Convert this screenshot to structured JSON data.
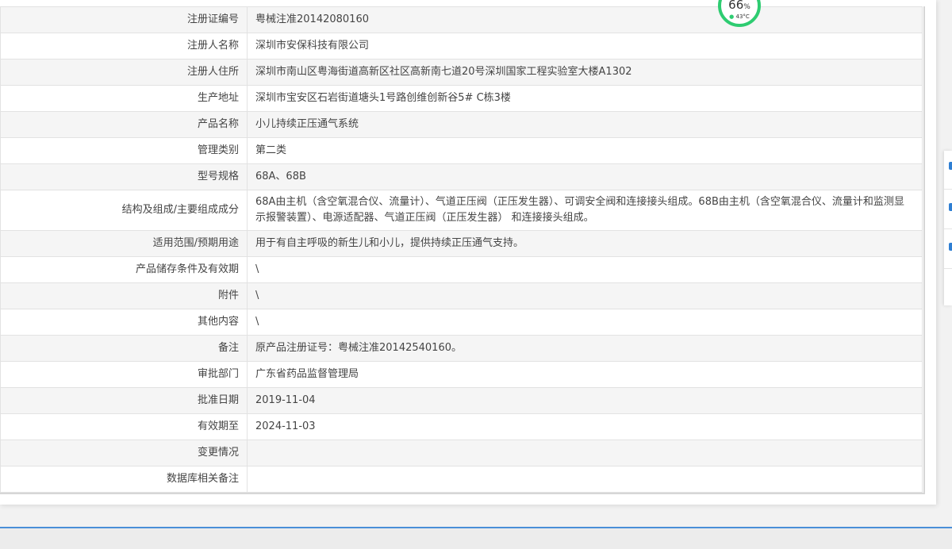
{
  "record": {
    "rows": [
      {
        "label": "注册证编号",
        "value": "粤械注准20142080160"
      },
      {
        "label": "注册人名称",
        "value": "深圳市安保科技有限公司"
      },
      {
        "label": "注册人住所",
        "value": "深圳市南山区粤海街道高新区社区高新南七道20号深圳国家工程实验室大楼A1302"
      },
      {
        "label": "生产地址",
        "value": "深圳市宝安区石岩街道塘头1号路创维创新谷5# C栋3楼"
      },
      {
        "label": "产品名称",
        "value": "小儿持续正压通气系统"
      },
      {
        "label": "管理类别",
        "value": "第二类"
      },
      {
        "label": "型号规格",
        "value": "68A、68B"
      },
      {
        "label": "结构及组成/主要组成成分",
        "value": "68A由主机（含空氧混合仪、流量计）、气道正压阀（正压发生器）、可调安全阀和连接接头组成。68B由主机（含空氧混合仪、流量计和监测显示报警装置）、电源适配器、气道正压阀（正压发生器） 和连接接头组成。"
      },
      {
        "label": "适用范围/预期用途",
        "value": "用于有自主呼吸的新生儿和小儿，提供持续正压通气支持。"
      },
      {
        "label": "产品储存条件及有效期",
        "value": "\\"
      },
      {
        "label": "附件",
        "value": "\\"
      },
      {
        "label": "其他内容",
        "value": "\\"
      },
      {
        "label": "备注",
        "value": "原产品注册证号：粤械注准20142540160。"
      },
      {
        "label": "审批部门",
        "value": "广东省药品监督管理局"
      },
      {
        "label": "批准日期",
        "value": "2019-11-04"
      },
      {
        "label": "有效期至",
        "value": "2024-11-03"
      },
      {
        "label": "变更情况",
        "value": ""
      },
      {
        "label": "数据库相关备注",
        "value": ""
      }
    ]
  },
  "widget": {
    "percent": "66",
    "percent_unit": "%",
    "temperature": "43°C",
    "icon": "thermometer-icon",
    "color": "#2ecc71"
  },
  "colors": {
    "row_alt": "#f5f5f5",
    "border": "#e2e2e2",
    "footer_accent": "#4a8fd8"
  }
}
